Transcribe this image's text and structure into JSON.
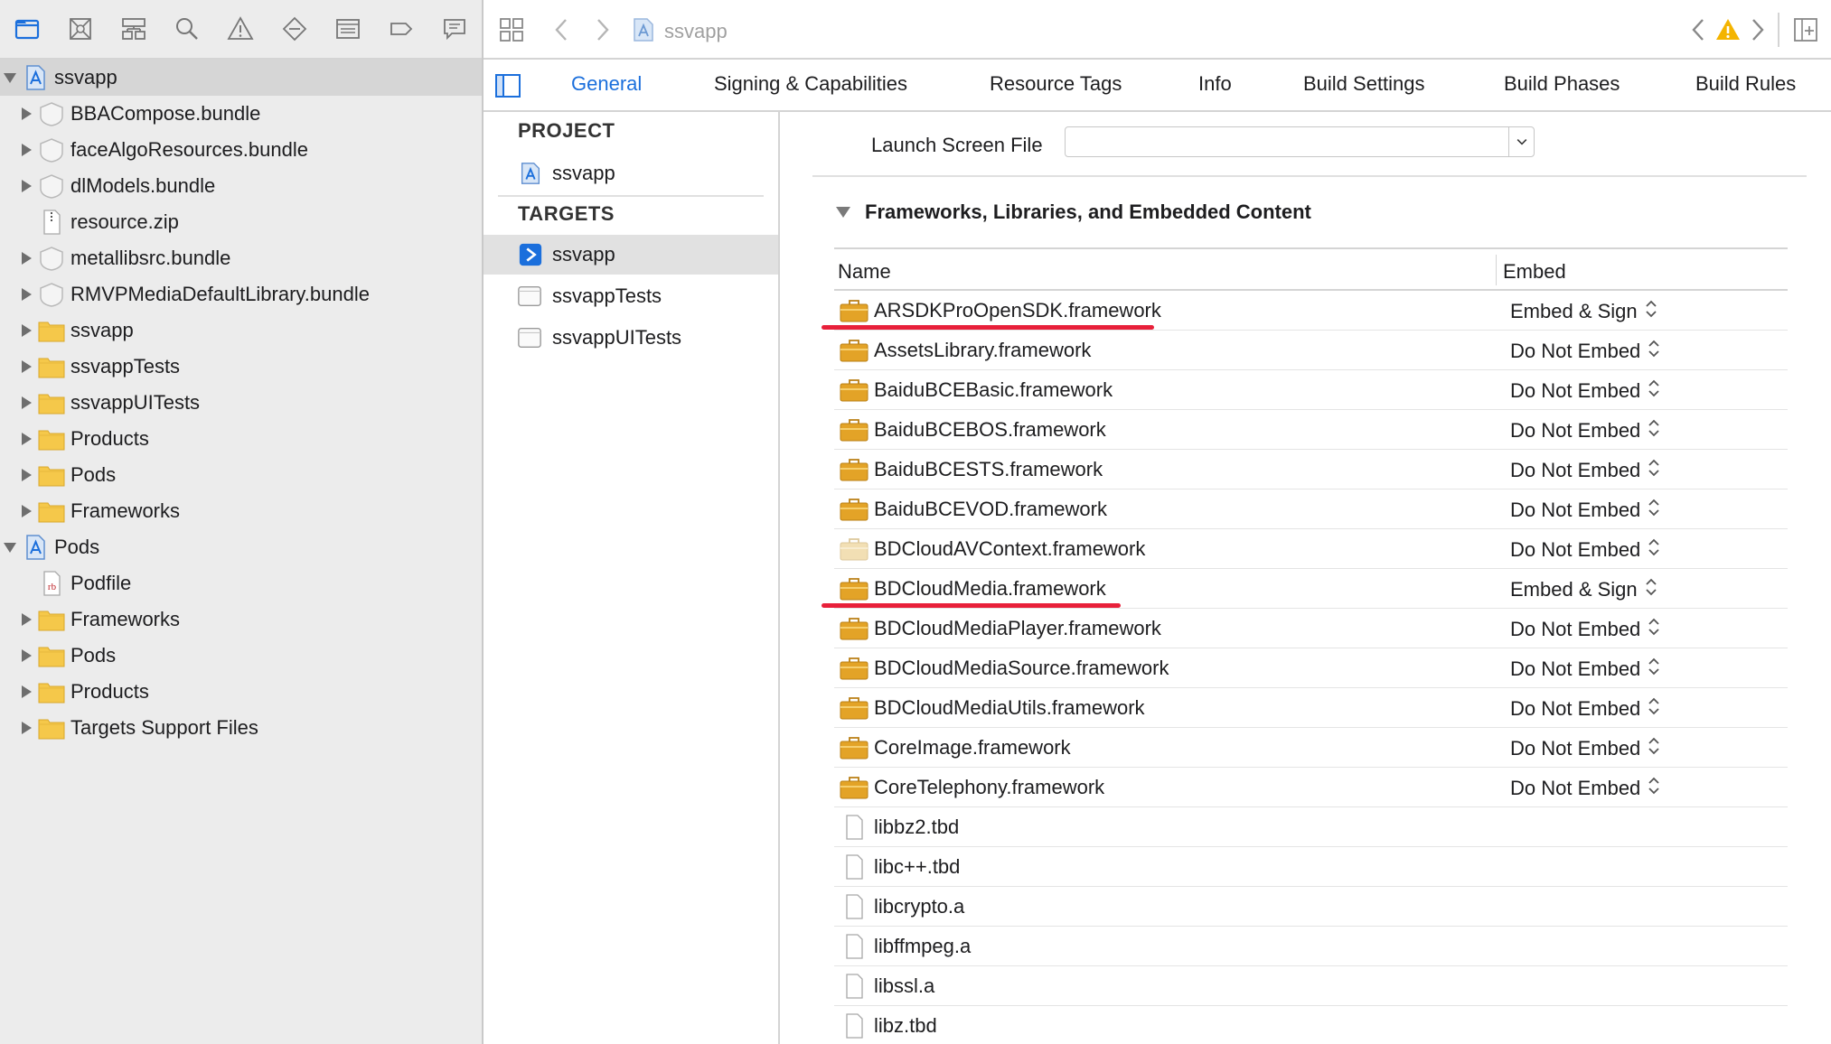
{
  "navigator": {
    "items": [
      {
        "label": "ssvapp",
        "level": 0,
        "icon": "project-icon",
        "disclosure": "open",
        "selected": true
      },
      {
        "label": "BBACompose.bundle",
        "level": 1,
        "icon": "bundle-icon",
        "disclosure": "closed"
      },
      {
        "label": "faceAlgoResources.bundle",
        "level": 1,
        "icon": "bundle-icon",
        "disclosure": "closed"
      },
      {
        "label": "dlModels.bundle",
        "level": 1,
        "icon": "bundle-icon",
        "disclosure": "closed"
      },
      {
        "label": "resource.zip",
        "level": 1,
        "icon": "zip-file-icon",
        "disclosure": "none"
      },
      {
        "label": "metallibsrc.bundle",
        "level": 1,
        "icon": "bundle-icon",
        "disclosure": "closed"
      },
      {
        "label": "RMVPMediaDefaultLibrary.bundle",
        "level": 1,
        "icon": "bundle-icon",
        "disclosure": "closed"
      },
      {
        "label": "ssvapp",
        "level": 1,
        "icon": "folder-icon",
        "disclosure": "closed"
      },
      {
        "label": "ssvappTests",
        "level": 1,
        "icon": "folder-icon",
        "disclosure": "closed"
      },
      {
        "label": "ssvappUITests",
        "level": 1,
        "icon": "folder-icon",
        "disclosure": "closed"
      },
      {
        "label": "Products",
        "level": 1,
        "icon": "folder-icon",
        "disclosure": "closed"
      },
      {
        "label": "Pods",
        "level": 1,
        "icon": "folder-icon",
        "disclosure": "closed"
      },
      {
        "label": "Frameworks",
        "level": 1,
        "icon": "folder-icon",
        "disclosure": "closed"
      },
      {
        "label": "Pods",
        "level": 0,
        "icon": "project-icon",
        "disclosure": "open"
      },
      {
        "label": "Podfile",
        "level": 1,
        "icon": "ruby-file-icon",
        "disclosure": "none"
      },
      {
        "label": "Frameworks",
        "level": 1,
        "icon": "folder-icon",
        "disclosure": "closed"
      },
      {
        "label": "Pods",
        "level": 1,
        "icon": "folder-icon",
        "disclosure": "closed"
      },
      {
        "label": "Products",
        "level": 1,
        "icon": "folder-icon",
        "disclosure": "closed"
      },
      {
        "label": "Targets Support Files",
        "level": 1,
        "icon": "folder-icon",
        "disclosure": "closed"
      }
    ]
  },
  "editor": {
    "breadcrumb": "ssvapp"
  },
  "tabs": [
    {
      "label": "General",
      "active": true
    },
    {
      "label": "Signing & Capabilities"
    },
    {
      "label": "Resource Tags"
    },
    {
      "label": "Info"
    },
    {
      "label": "Build Settings"
    },
    {
      "label": "Build Phases"
    },
    {
      "label": "Build Rules"
    }
  ],
  "targets_panel": {
    "project_header": "PROJECT",
    "project_item": "ssvapp",
    "targets_header": "TARGETS",
    "targets": [
      {
        "label": "ssvapp",
        "selected": true,
        "icon": "app-target-icon"
      },
      {
        "label": "ssvappTests",
        "icon": "test-target-icon"
      },
      {
        "label": "ssvappUITests",
        "icon": "test-target-icon"
      }
    ]
  },
  "general": {
    "launch_screen_label": "Launch Screen File",
    "launch_screen_value": "",
    "section_title": "Frameworks, Libraries, and Embedded Content",
    "col_name": "Name",
    "col_embed": "Embed",
    "frameworks": [
      {
        "name": "ARSDKProOpenSDK.framework",
        "embed": "Embed & Sign",
        "icon": "framework-icon",
        "highlight": true
      },
      {
        "name": "AssetsLibrary.framework",
        "embed": "Do Not Embed",
        "icon": "framework-icon"
      },
      {
        "name": "BaiduBCEBasic.framework",
        "embed": "Do Not Embed",
        "icon": "framework-icon"
      },
      {
        "name": "BaiduBCEBOS.framework",
        "embed": "Do Not Embed",
        "icon": "framework-icon"
      },
      {
        "name": "BaiduBCESTS.framework",
        "embed": "Do Not Embed",
        "icon": "framework-icon"
      },
      {
        "name": "BaiduBCEVOD.framework",
        "embed": "Do Not Embed",
        "icon": "framework-icon"
      },
      {
        "name": "BDCloudAVContext.framework",
        "embed": "Do Not Embed",
        "icon": "framework-faded-icon"
      },
      {
        "name": "BDCloudMedia.framework",
        "embed": "Embed & Sign",
        "icon": "framework-icon",
        "highlight": true
      },
      {
        "name": "BDCloudMediaPlayer.framework",
        "embed": "Do Not Embed",
        "icon": "framework-icon"
      },
      {
        "name": "BDCloudMediaSource.framework",
        "embed": "Do Not Embed",
        "icon": "framework-icon"
      },
      {
        "name": "BDCloudMediaUtils.framework",
        "embed": "Do Not Embed",
        "icon": "framework-icon"
      },
      {
        "name": "CoreImage.framework",
        "embed": "Do Not Embed",
        "icon": "framework-icon"
      },
      {
        "name": "CoreTelephony.framework",
        "embed": "Do Not Embed",
        "icon": "framework-icon"
      },
      {
        "name": "libbz2.tbd",
        "embed": "",
        "icon": "file-icon"
      },
      {
        "name": "libc++.tbd",
        "embed": "",
        "icon": "file-icon"
      },
      {
        "name": "libcrypto.a",
        "embed": "",
        "icon": "file-icon"
      },
      {
        "name": "libffmpeg.a",
        "embed": "",
        "icon": "file-icon"
      },
      {
        "name": "libssl.a",
        "embed": "",
        "icon": "file-icon"
      },
      {
        "name": "libz.tbd",
        "embed": "",
        "icon": "file-icon"
      }
    ]
  },
  "colors": {
    "accent": "#1b6fdc",
    "highlight_underline": "#e8203a",
    "folder": "#f5c84a",
    "framework": "#e3a327",
    "warning": "#f4b400"
  }
}
